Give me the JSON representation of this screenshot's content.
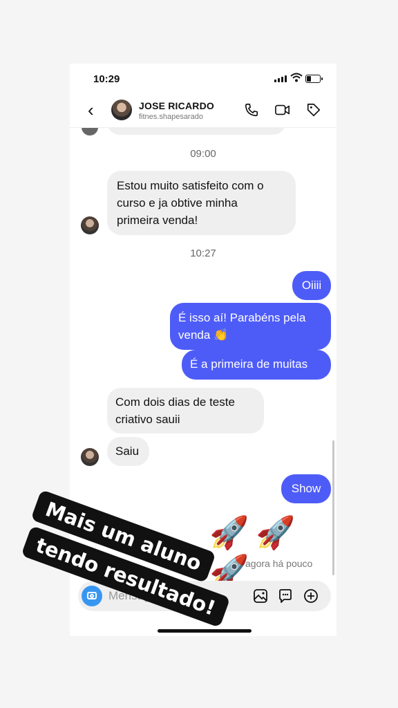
{
  "status": {
    "time": "10:29"
  },
  "header": {
    "name": "JOSE RICARDO",
    "username": "fitnes.shapesarado",
    "icons": [
      "back-icon",
      "phone-icon",
      "video-icon",
      "tag-icon"
    ]
  },
  "messages": {
    "stamp1": "09:00",
    "in1_line1": "Estou muito satisfeito com o",
    "in1_line2": "curso e ja obtive minha",
    "in1_line3": "primeira venda!",
    "stamp2": "10:27",
    "out1": "Oiiii",
    "out2_line1": "É isso aí! Parabéns pela",
    "out2_line2": "venda 👏",
    "out3": "É a primeira de muitas",
    "in2_line1": "Com dois dias de teste",
    "in2_line2": "criativo sauii",
    "in3": "Saiu",
    "out4": "Show",
    "rockets": "🚀🚀🚀",
    "seen": "agora há pouco"
  },
  "composer": {
    "placeholder": "Mensagem..."
  },
  "overlay": {
    "line1": "Mais um aluno",
    "line2": "tendo resultado!"
  },
  "colors": {
    "outgoing": "#4e5cf7",
    "incoming": "#efefef",
    "camera": "#3797f0"
  }
}
